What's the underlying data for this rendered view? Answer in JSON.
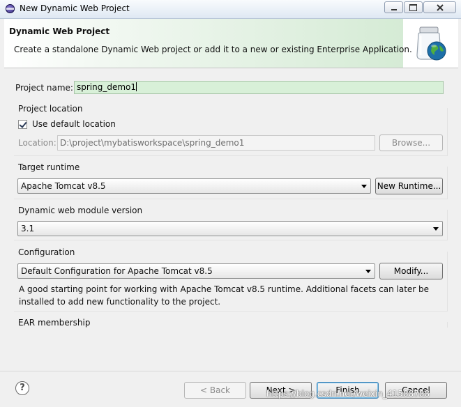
{
  "window": {
    "title": "New Dynamic Web Project"
  },
  "banner": {
    "title": "Dynamic Web Project",
    "description": "Create a standalone Dynamic Web project or add it to a new or existing Enterprise Application."
  },
  "project": {
    "name_label": "Project name:",
    "name_value": "spring_demo1"
  },
  "location": {
    "group_label": "Project location",
    "use_default_label": "Use default location",
    "use_default_checked": true,
    "location_label": "Location:",
    "location_value": "D:\\project\\mybatisworkspace\\spring_demo1",
    "browse_label": "Browse..."
  },
  "runtime": {
    "group_label": "Target runtime",
    "selected": "Apache Tomcat v8.5",
    "new_runtime_label": "New Runtime..."
  },
  "module_version": {
    "group_label": "Dynamic web module version",
    "selected": "3.1"
  },
  "configuration": {
    "group_label": "Configuration",
    "selected": "Default Configuration for Apache Tomcat v8.5",
    "modify_label": "Modify...",
    "description_line1": "A good starting point for working with Apache Tomcat v8.5 runtime. Additional facets can later be",
    "description_line2": "installed to add new functionality to the project."
  },
  "ear": {
    "group_label": "EAR membership"
  },
  "footer": {
    "back_label": "< Back",
    "next_label": "Next >",
    "finish_label": "Finish",
    "cancel_label": "Cancel",
    "help_symbol": "?"
  },
  "watermark": "https://blog.csdn.net/weixin_41588788",
  "icons": [
    "app-icon",
    "wizard-jar-globe-icon",
    "help-icon",
    "dropdown-arrow-icon",
    "checkbox-checked-icon"
  ]
}
